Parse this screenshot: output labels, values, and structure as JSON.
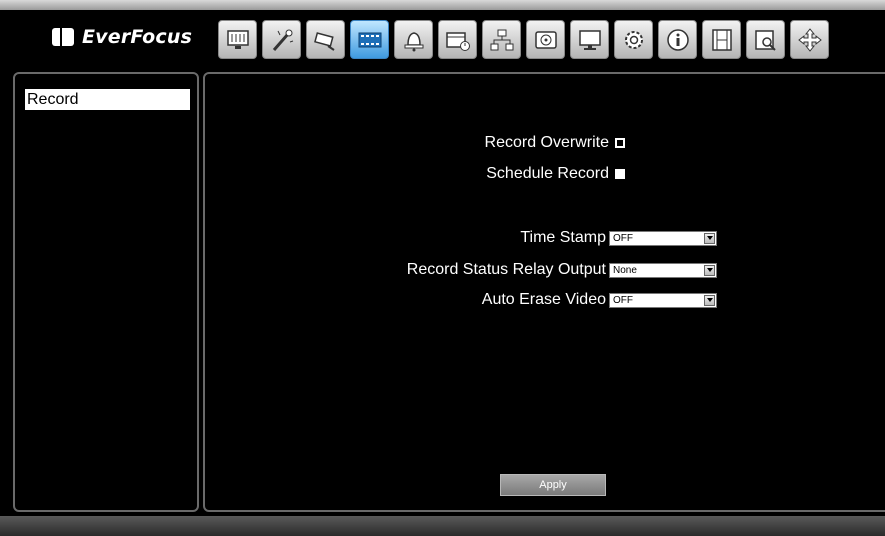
{
  "brand": {
    "name": "EverFocus"
  },
  "toolbar": {
    "buttons": [
      {
        "icon": "display-icon",
        "active": false
      },
      {
        "icon": "magic-wand-icon",
        "active": false
      },
      {
        "icon": "camera-icon",
        "active": false
      },
      {
        "icon": "record-film-icon",
        "active": true
      },
      {
        "icon": "alarm-bell-icon",
        "active": false
      },
      {
        "icon": "schedule-icon",
        "active": false
      },
      {
        "icon": "network-icon",
        "active": false
      },
      {
        "icon": "disk-icon",
        "active": false
      },
      {
        "icon": "monitor-icon",
        "active": false
      },
      {
        "icon": "settings-gear-icon",
        "active": false
      },
      {
        "icon": "info-icon",
        "active": false
      },
      {
        "icon": "film-strip-icon",
        "active": false
      },
      {
        "icon": "search-icon",
        "active": false
      },
      {
        "icon": "ptz-arrows-icon",
        "active": false
      }
    ]
  },
  "sidebar": {
    "items": [
      {
        "label": "Record",
        "selected": true
      }
    ]
  },
  "form": {
    "record_overwrite": {
      "label": "Record Overwrite",
      "checked": true
    },
    "schedule_record": {
      "label": "Schedule Record",
      "checked": false
    },
    "time_stamp": {
      "label": "Time Stamp",
      "value": "OFF"
    },
    "record_status_relay_output": {
      "label": "Record Status Relay Output",
      "value": "None"
    },
    "auto_erase_video": {
      "label": "Auto Erase Video",
      "value": "OFF"
    }
  },
  "actions": {
    "apply_label": "Apply"
  },
  "colors": {
    "active_tab": "#3f9ae0",
    "background": "#000000",
    "panel_border": "#6a6a6a"
  }
}
